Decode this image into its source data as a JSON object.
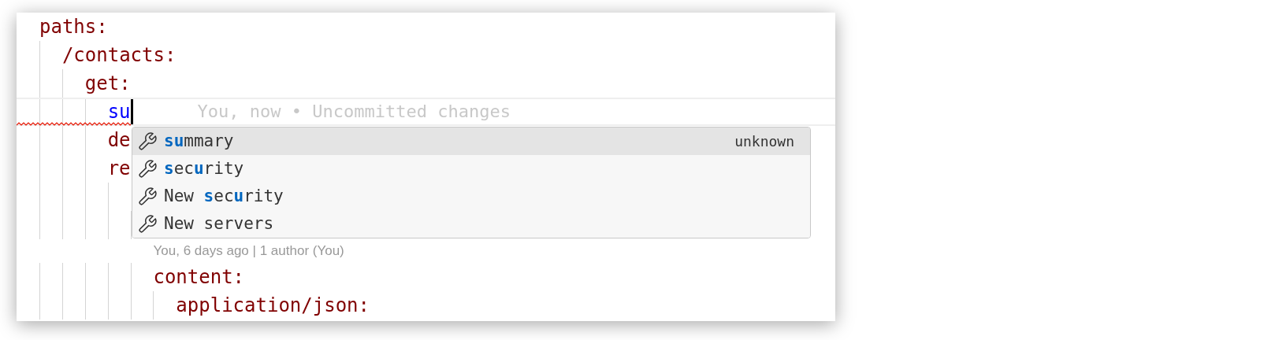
{
  "editor": {
    "lines": [
      {
        "text": "paths:",
        "kind": "key",
        "children": [
          {
            "text": "/contacts:",
            "kind": "key",
            "children": [
              {
                "text": "get:",
                "kind": "key",
                "children": [
                  {
                    "text": "su",
                    "kind": "current",
                    "error": true,
                    "ghost": "You, now • Uncommitted changes"
                  },
                  {
                    "text": "de",
                    "kind": "key"
                  },
                  {
                    "text": "re",
                    "kind": "key",
                    "children": [
                      {
                        "kind": "covered",
                        "children": [
                          {
                            "kind": "covered"
                          },
                          {
                            "text": "content:",
                            "kind": "key",
                            "codelens": "You, 6 days ago | 1 author (You)",
                            "children": [
                              {
                                "text": "application/json:",
                                "kind": "key"
                              }
                            ]
                          }
                        ]
                      }
                    ]
                  }
                ]
              }
            ]
          }
        ]
      }
    ]
  },
  "suggestions": [
    {
      "label": "**su**mmary",
      "detail": "unknown",
      "selected": true
    },
    {
      "label": "**s**ec**u**rity",
      "selected": false
    },
    {
      "label": "New **s**ec**u**rity",
      "selected": false
    },
    {
      "label": "New servers",
      "selected": false
    }
  ]
}
